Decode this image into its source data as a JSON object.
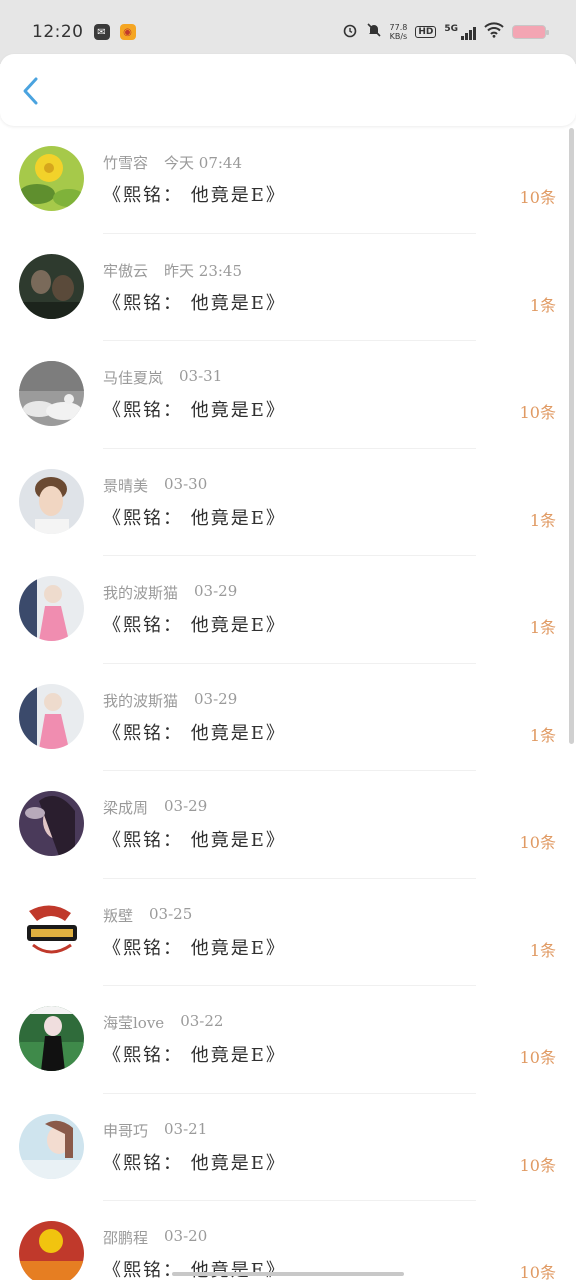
{
  "status_bar": {
    "time": "12:20",
    "net_speed_value": "77.8",
    "net_speed_unit": "KB/s",
    "hd_label": "HD",
    "signal_label": "5G"
  },
  "header": {
    "back_icon": "chevron-left-icon"
  },
  "colors": {
    "accent": "#4aa3df",
    "count": "#e09a63",
    "meta": "#9a9a9a",
    "title": "#2f2f2f"
  },
  "items": [
    {
      "name": "竹雪容",
      "date": "今天 07:44",
      "title": "《熙铭：  他竟是E》",
      "count": "10条"
    },
    {
      "name": "牢傲云",
      "date": "昨天 23:45",
      "title": "《熙铭：  他竟是E》",
      "count": "1条"
    },
    {
      "name": "马佳夏岚",
      "date": "03-31",
      "title": "《熙铭：  他竟是E》",
      "count": "10条"
    },
    {
      "name": "景晴美",
      "date": "03-30",
      "title": "《熙铭：  他竟是E》",
      "count": "1条"
    },
    {
      "name": "我的波斯猫",
      "date": "03-29",
      "title": "《熙铭：  他竟是E》",
      "count": "1条"
    },
    {
      "name": "我的波斯猫",
      "date": "03-29",
      "title": "《熙铭：  他竟是E》",
      "count": "1条"
    },
    {
      "name": "梁成周",
      "date": "03-29",
      "title": "《熙铭：  他竟是E》",
      "count": "10条"
    },
    {
      "name": "叛壁",
      "date": "03-25",
      "title": "《熙铭：  他竟是E》",
      "count": "1条"
    },
    {
      "name": "海莹love",
      "date": "03-22",
      "title": "《熙铭：  他竟是E》",
      "count": "10条"
    },
    {
      "name": "申哥巧",
      "date": "03-21",
      "title": "《熙铭：  他竟是E》",
      "count": "10条"
    },
    {
      "name": "邵鹏程",
      "date": "03-20",
      "title": "《熙铭：  他竟是E》",
      "count": "10条"
    }
  ]
}
